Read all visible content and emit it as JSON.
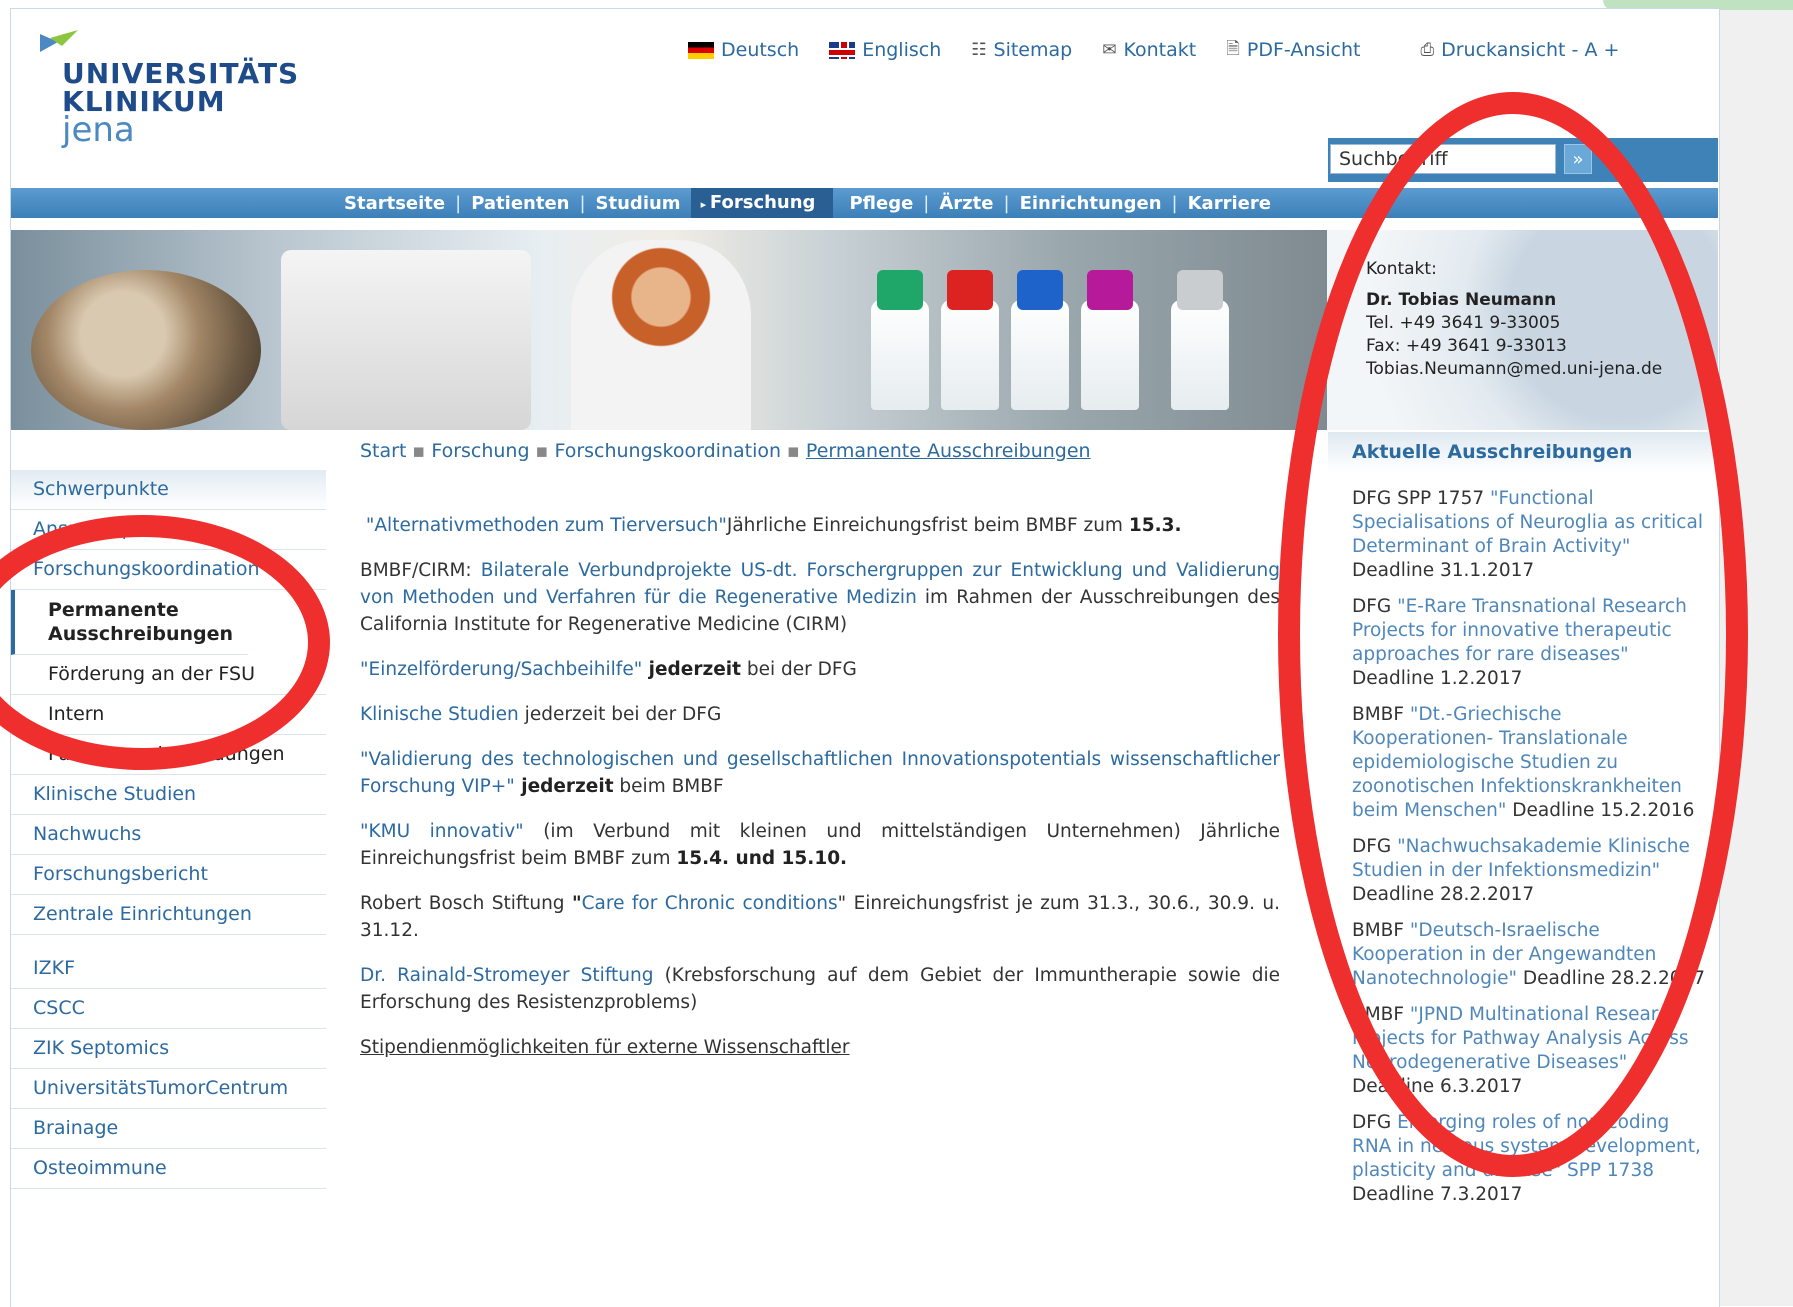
{
  "logo": {
    "line1": "UNIVERSITÄTS",
    "line2": "KLINIKUM",
    "line3": "jena"
  },
  "top_links": [
    {
      "label": "Deutsch",
      "icon": "flag-de-icon"
    },
    {
      "label": "Englisch",
      "icon": "flag-uk-icon"
    },
    {
      "label": "Sitemap",
      "icon": "sitemap-icon"
    },
    {
      "label": "Kontakt",
      "icon": "mail-icon"
    },
    {
      "label": "PDF-Ansicht",
      "icon": "pdf-icon"
    },
    {
      "label": "Druckansicht - A +",
      "icon": "print-icon"
    }
  ],
  "search": {
    "value": "Suchbegriff",
    "button": "»"
  },
  "nav": {
    "items": [
      "Startseite",
      "Patienten",
      "Studium",
      "Forschung",
      "Pflege",
      "Ärzte",
      "Einrichtungen",
      "Karriere"
    ],
    "active": "Forschung",
    "separator": "|"
  },
  "contact": {
    "label": "Kontakt:",
    "name": "Dr. Tobias Neumann",
    "tel": "Tel. +49 3641 9-33005",
    "fax": "Fax: +49 3641 9-33013",
    "email": "Tobias.Neumann@med.uni-jena.de"
  },
  "breadcrumb": [
    "Start",
    "Forschung",
    "Forschungskoordination",
    "Permanente Ausschreibungen"
  ],
  "breadcrumb_sep": "▪",
  "sidebar": {
    "items_top": [
      "Schwerpunkte",
      "Ansprechpartner",
      "Forschungskoordination"
    ],
    "current": "Permanente Ausschreibungen",
    "subitems": [
      "Förderung an der FSU",
      "Intern",
      "Patente und Erfindungen"
    ],
    "items_mid": [
      "Klinische Studien",
      "Nachwuchs",
      "Forschungsbericht",
      "Zentrale Einrichtungen"
    ],
    "items_bottom": [
      "IZKF",
      "CSCC",
      "ZIK Septomics",
      "UniversitätsTumorCentrum",
      "Brainage",
      "Osteoimmune"
    ]
  },
  "content": {
    "p1": {
      "link": "\"Alternativmethoden zum Tierversuch\"",
      "text": "Jährliche Einreichungsfrist beim BMBF zum ",
      "bold": "15.3."
    },
    "p2": {
      "prefix": "BMBF/CIRM: ",
      "link": "Bilaterale Verbundprojekte US-dt. Forschergruppen zur Entwicklung und Validierung von Methoden und Verfahren für die Regenerative Medizin",
      "text": " im Rahmen der Ausschreibungen des California Institute for Regenerative Medicine (CIRM)"
    },
    "p3": {
      "link": "\"Einzelförderung/Sachbeihilfe\"",
      "bold": " jederzeit",
      "text": " bei der DFG"
    },
    "p4": {
      "link": "Klinische Studien",
      "text": " jederzeit bei der DFG"
    },
    "p5": {
      "link": "\"Validierung des technologischen und gesellschaftlichen Innovationspotentials wissenschaftlicher Forschung VIP+\"",
      "bold": " jederzeit",
      "text": " beim BMBF"
    },
    "p6": {
      "link": "\"KMU innovativ\"",
      "text": " (im Verbund mit kleinen und mittelständigen Unternehmen) Jährliche Einreichungsfrist beim BMBF zum ",
      "bold": "15.4. und 15.10."
    },
    "p7": {
      "prefix": "Robert Bosch Stiftung ",
      "bold": "\"",
      "link": "Care for Chronic conditions",
      "text": "\" Einreichungsfrist je zum 31.3., 30.6., 30.9. u. 31.12."
    },
    "p8": {
      "link": "Dr. Rainald-Stromeyer Stiftung",
      "text": " (Krebsforschung auf dem Gebiet der Immuntherapie sowie die Erforschung des Resistenzproblems)"
    },
    "p9": {
      "text": "Stipendienmöglichkeiten für externe Wissenschaftler"
    }
  },
  "right": {
    "heading": "Aktuelle Ausschreibungen",
    "items": [
      {
        "org": "DFG SPP 1757 ",
        "link": "\"Functional Specialisations of Neuroglia as critical Determinant of Brain Activity\"",
        "deadline": " Deadline 31.1.2017"
      },
      {
        "org": "DFG ",
        "link": "\"E-Rare Transnational Research Projects for innovative therapeutic approaches for rare diseases\"",
        "deadline": " Deadline 1.2.2017"
      },
      {
        "org": "BMBF ",
        "link": "\"Dt.-Griechische Kooperationen- Translationale epidemiologische Studien zu zoonotischen Infektionskrankheiten beim Menschen\"",
        "deadline": " Deadline 15.2.2016"
      },
      {
        "org": "DFG ",
        "link": "\"Nachwuchsakademie Klinische Studien in der Infektionsmedizin\"",
        "deadline": " Deadline 28.2.2017"
      },
      {
        "org": "BMBF ",
        "link": "\"Deutsch-Israelische Kooperation in der Angewandten Nanotechnologie\"",
        "deadline": " Deadline 28.2.2017"
      },
      {
        "org": "BMBF ",
        "link": "\"JPND Multinational Research Projects for Pathway Analysis Across Neurodegenerative Diseases\"",
        "deadline": " Deadline 6.3.2017"
      },
      {
        "org": "DFG ",
        "link": "Emerging roles of non-coding RNA in nervous system development, plasticity and disease\" SPP 1738",
        "deadline": " Deadline 7.3.2017"
      }
    ]
  },
  "colors": {
    "brand": "#1e4b8a",
    "nav": "#3d80b8",
    "link": "#2c6aa0",
    "annotation": "#ef2e2e"
  }
}
